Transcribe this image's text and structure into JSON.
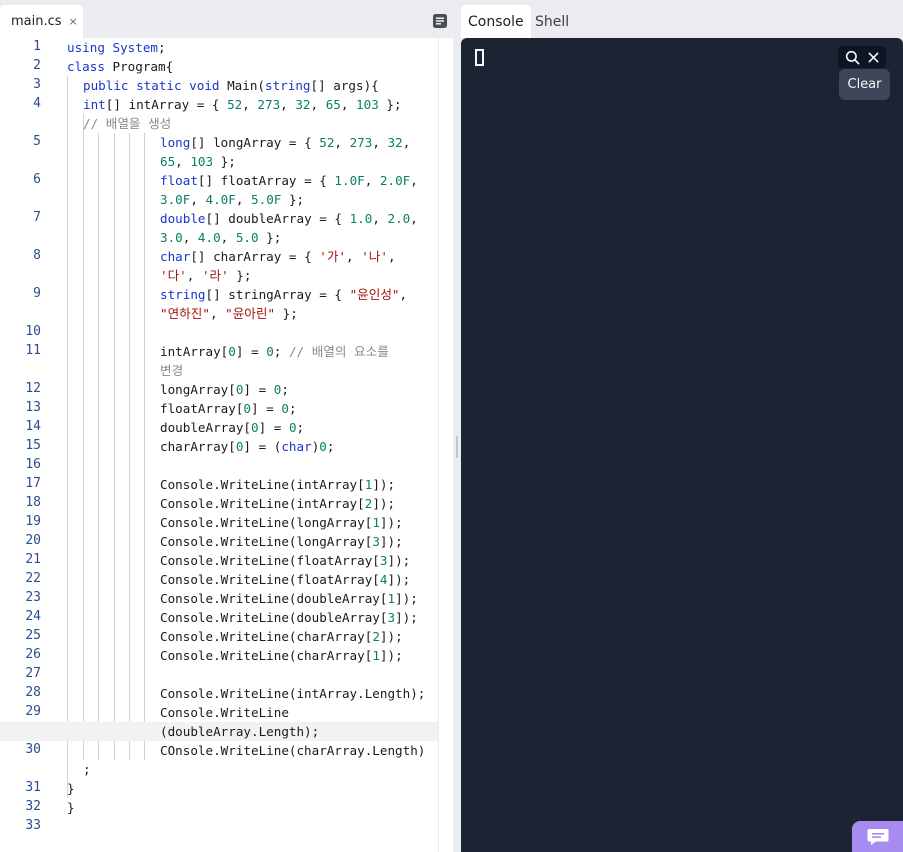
{
  "editor": {
    "file_tab": {
      "name": "main.cs",
      "close": "×"
    },
    "lines": [
      {
        "n": "1",
        "segs": [
          [
            "using ",
            "kw"
          ],
          [
            "System",
            "kw"
          ],
          [
            ";",
            ""
          ]
        ]
      },
      {
        "n": "2",
        "segs": [
          [
            "class ",
            "kw"
          ],
          [
            "Program{",
            ""
          ]
        ]
      },
      {
        "n": "3",
        "segs": [
          [
            "public ",
            "kw"
          ],
          [
            "static ",
            "kw"
          ],
          [
            "void ",
            "kw"
          ],
          [
            "Main(",
            ""
          ],
          [
            "string",
            "kw"
          ],
          [
            "[] args){",
            ""
          ]
        ]
      },
      {
        "n": "4",
        "segs": [
          [
            "int",
            "kw"
          ],
          [
            "[] intArray = { ",
            ""
          ],
          [
            "52",
            "num"
          ],
          [
            ", ",
            ""
          ],
          [
            "273",
            "num"
          ],
          [
            ", ",
            ""
          ],
          [
            "32",
            "num"
          ],
          [
            ", ",
            ""
          ],
          [
            "65",
            "num"
          ],
          [
            ", ",
            ""
          ],
          [
            "103",
            "num"
          ],
          [
            " };",
            ""
          ]
        ]
      },
      {
        "n": "",
        "segs": [
          [
            "// 배열을 생성",
            "cmt"
          ]
        ]
      },
      {
        "n": "5",
        "segs": [
          [
            "long",
            "kw"
          ],
          [
            "[] longArray = { ",
            ""
          ],
          [
            "52",
            "num"
          ],
          [
            ", ",
            ""
          ],
          [
            "273",
            "num"
          ],
          [
            ", ",
            ""
          ],
          [
            "32",
            "num"
          ],
          [
            ",",
            ""
          ]
        ]
      },
      {
        "n": "",
        "segs": [
          [
            "65",
            "num"
          ],
          [
            ", ",
            ""
          ],
          [
            "103",
            "num"
          ],
          [
            " };",
            ""
          ]
        ]
      },
      {
        "n": "6",
        "segs": [
          [
            "float",
            "kw"
          ],
          [
            "[] floatArray = { ",
            ""
          ],
          [
            "1.0F",
            "num"
          ],
          [
            ", ",
            ""
          ],
          [
            "2.0F",
            "num"
          ],
          [
            ",",
            ""
          ]
        ]
      },
      {
        "n": "",
        "segs": [
          [
            "3.0F",
            "num"
          ],
          [
            ", ",
            ""
          ],
          [
            "4.0F",
            "num"
          ],
          [
            ", ",
            ""
          ],
          [
            "5.0F",
            "num"
          ],
          [
            " };",
            ""
          ]
        ]
      },
      {
        "n": "7",
        "segs": [
          [
            "double",
            "kw"
          ],
          [
            "[] doubleArray = { ",
            ""
          ],
          [
            "1.0",
            "num"
          ],
          [
            ", ",
            ""
          ],
          [
            "2.0",
            "num"
          ],
          [
            ",",
            ""
          ]
        ]
      },
      {
        "n": "",
        "segs": [
          [
            "3.0",
            "num"
          ],
          [
            ", ",
            ""
          ],
          [
            "4.0",
            "num"
          ],
          [
            ", ",
            ""
          ],
          [
            "5.0",
            "num"
          ],
          [
            " };",
            ""
          ]
        ]
      },
      {
        "n": "8",
        "segs": [
          [
            "char",
            "kw"
          ],
          [
            "[] charArray = { ",
            ""
          ],
          [
            "'가'",
            "str"
          ],
          [
            ", ",
            ""
          ],
          [
            "'나'",
            "str"
          ],
          [
            ",",
            ""
          ]
        ]
      },
      {
        "n": "",
        "segs": [
          [
            "'다'",
            "str"
          ],
          [
            ", ",
            ""
          ],
          [
            "'라'",
            "str"
          ],
          [
            " };",
            ""
          ]
        ]
      },
      {
        "n": "9",
        "segs": [
          [
            "string",
            "kw"
          ],
          [
            "[] stringArray = { ",
            ""
          ],
          [
            "\"윤인성\"",
            "str"
          ],
          [
            ",",
            ""
          ]
        ]
      },
      {
        "n": "",
        "segs": [
          [
            "\"연하진\"",
            "str"
          ],
          [
            ", ",
            ""
          ],
          [
            "\"윤아린\"",
            "str"
          ],
          [
            " };",
            ""
          ]
        ]
      },
      {
        "n": "10",
        "segs": []
      },
      {
        "n": "11",
        "segs": [
          [
            "intArray[",
            ""
          ],
          [
            "0",
            "num"
          ],
          [
            "] = ",
            ""
          ],
          [
            "0",
            "num"
          ],
          [
            "; ",
            ""
          ],
          [
            "// 배열의 요소를",
            "cmt"
          ]
        ]
      },
      {
        "n": "",
        "segs": [
          [
            "변경",
            "cmt"
          ]
        ]
      },
      {
        "n": "12",
        "segs": [
          [
            "longArray[",
            ""
          ],
          [
            "0",
            "num"
          ],
          [
            "] = ",
            ""
          ],
          [
            "0",
            "num"
          ],
          [
            ";",
            ""
          ]
        ]
      },
      {
        "n": "13",
        "segs": [
          [
            "floatArray[",
            ""
          ],
          [
            "0",
            "num"
          ],
          [
            "] = ",
            ""
          ],
          [
            "0",
            "num"
          ],
          [
            ";",
            ""
          ]
        ]
      },
      {
        "n": "14",
        "segs": [
          [
            "doubleArray[",
            ""
          ],
          [
            "0",
            "num"
          ],
          [
            "] = ",
            ""
          ],
          [
            "0",
            "num"
          ],
          [
            ";",
            ""
          ]
        ]
      },
      {
        "n": "15",
        "segs": [
          [
            "charArray[",
            ""
          ],
          [
            "0",
            "num"
          ],
          [
            "] = (",
            ""
          ],
          [
            "char",
            "kw"
          ],
          [
            ")",
            ""
          ],
          [
            "0",
            "num"
          ],
          [
            ";",
            ""
          ]
        ]
      },
      {
        "n": "16",
        "segs": []
      },
      {
        "n": "17",
        "segs": [
          [
            "Console.WriteLine(intArray[",
            ""
          ],
          [
            "1",
            "num"
          ],
          [
            "]);",
            ""
          ]
        ]
      },
      {
        "n": "18",
        "segs": [
          [
            "Console.WriteLine(intArray[",
            ""
          ],
          [
            "2",
            "num"
          ],
          [
            "]);",
            ""
          ]
        ]
      },
      {
        "n": "19",
        "segs": [
          [
            "Console.WriteLine(longArray[",
            ""
          ],
          [
            "1",
            "num"
          ],
          [
            "]);",
            ""
          ]
        ]
      },
      {
        "n": "20",
        "segs": [
          [
            "Console.WriteLine(longArray[",
            ""
          ],
          [
            "3",
            "num"
          ],
          [
            "]);",
            ""
          ]
        ]
      },
      {
        "n": "21",
        "segs": [
          [
            "Console.WriteLine(floatArray[",
            ""
          ],
          [
            "3",
            "num"
          ],
          [
            "]);",
            ""
          ]
        ]
      },
      {
        "n": "22",
        "segs": [
          [
            "Console.WriteLine(floatArray[",
            ""
          ],
          [
            "4",
            "num"
          ],
          [
            "]);",
            ""
          ]
        ]
      },
      {
        "n": "23",
        "segs": [
          [
            "Console.WriteLine(doubleArray[",
            ""
          ],
          [
            "1",
            "num"
          ],
          [
            "]);",
            ""
          ]
        ]
      },
      {
        "n": "24",
        "segs": [
          [
            "Console.WriteLine(doubleArray[",
            ""
          ],
          [
            "3",
            "num"
          ],
          [
            "]);",
            ""
          ]
        ]
      },
      {
        "n": "25",
        "segs": [
          [
            "Console.WriteLine(charArray[",
            ""
          ],
          [
            "2",
            "num"
          ],
          [
            "]);",
            ""
          ]
        ]
      },
      {
        "n": "26",
        "segs": [
          [
            "Console.WriteLine(charArray[",
            ""
          ],
          [
            "1",
            "num"
          ],
          [
            "]);",
            ""
          ]
        ]
      },
      {
        "n": "27",
        "segs": []
      },
      {
        "n": "28",
        "segs": [
          [
            "Console.WriteLine(intArray.Length);",
            ""
          ]
        ]
      },
      {
        "n": "29",
        "segs": [
          [
            "Console.WriteLine",
            ""
          ]
        ]
      },
      {
        "n": "",
        "segs": [
          [
            "(doubleArray.Length);",
            ""
          ]
        ]
      },
      {
        "n": "30",
        "segs": [
          [
            "COnsole.WriteLine(charArray.Length)",
            ""
          ]
        ]
      },
      {
        "n": "",
        "segs": [
          [
            ";",
            ""
          ]
        ]
      },
      {
        "n": "31",
        "segs": [
          [
            "}",
            ""
          ]
        ]
      },
      {
        "n": "32",
        "segs": [
          [
            "}",
            ""
          ]
        ]
      },
      {
        "n": "33",
        "segs": []
      }
    ]
  },
  "right_panel": {
    "tabs": [
      "Console",
      "Shell"
    ],
    "active_tab": "Console",
    "clear_label": "Clear"
  },
  "colors": {
    "keyword": "#1a36c9",
    "number": "#0b7e6a",
    "string": "#a31515",
    "comment": "#8a8a8a",
    "console_bg": "#1c2333",
    "chat_button": "#a88bf0"
  }
}
